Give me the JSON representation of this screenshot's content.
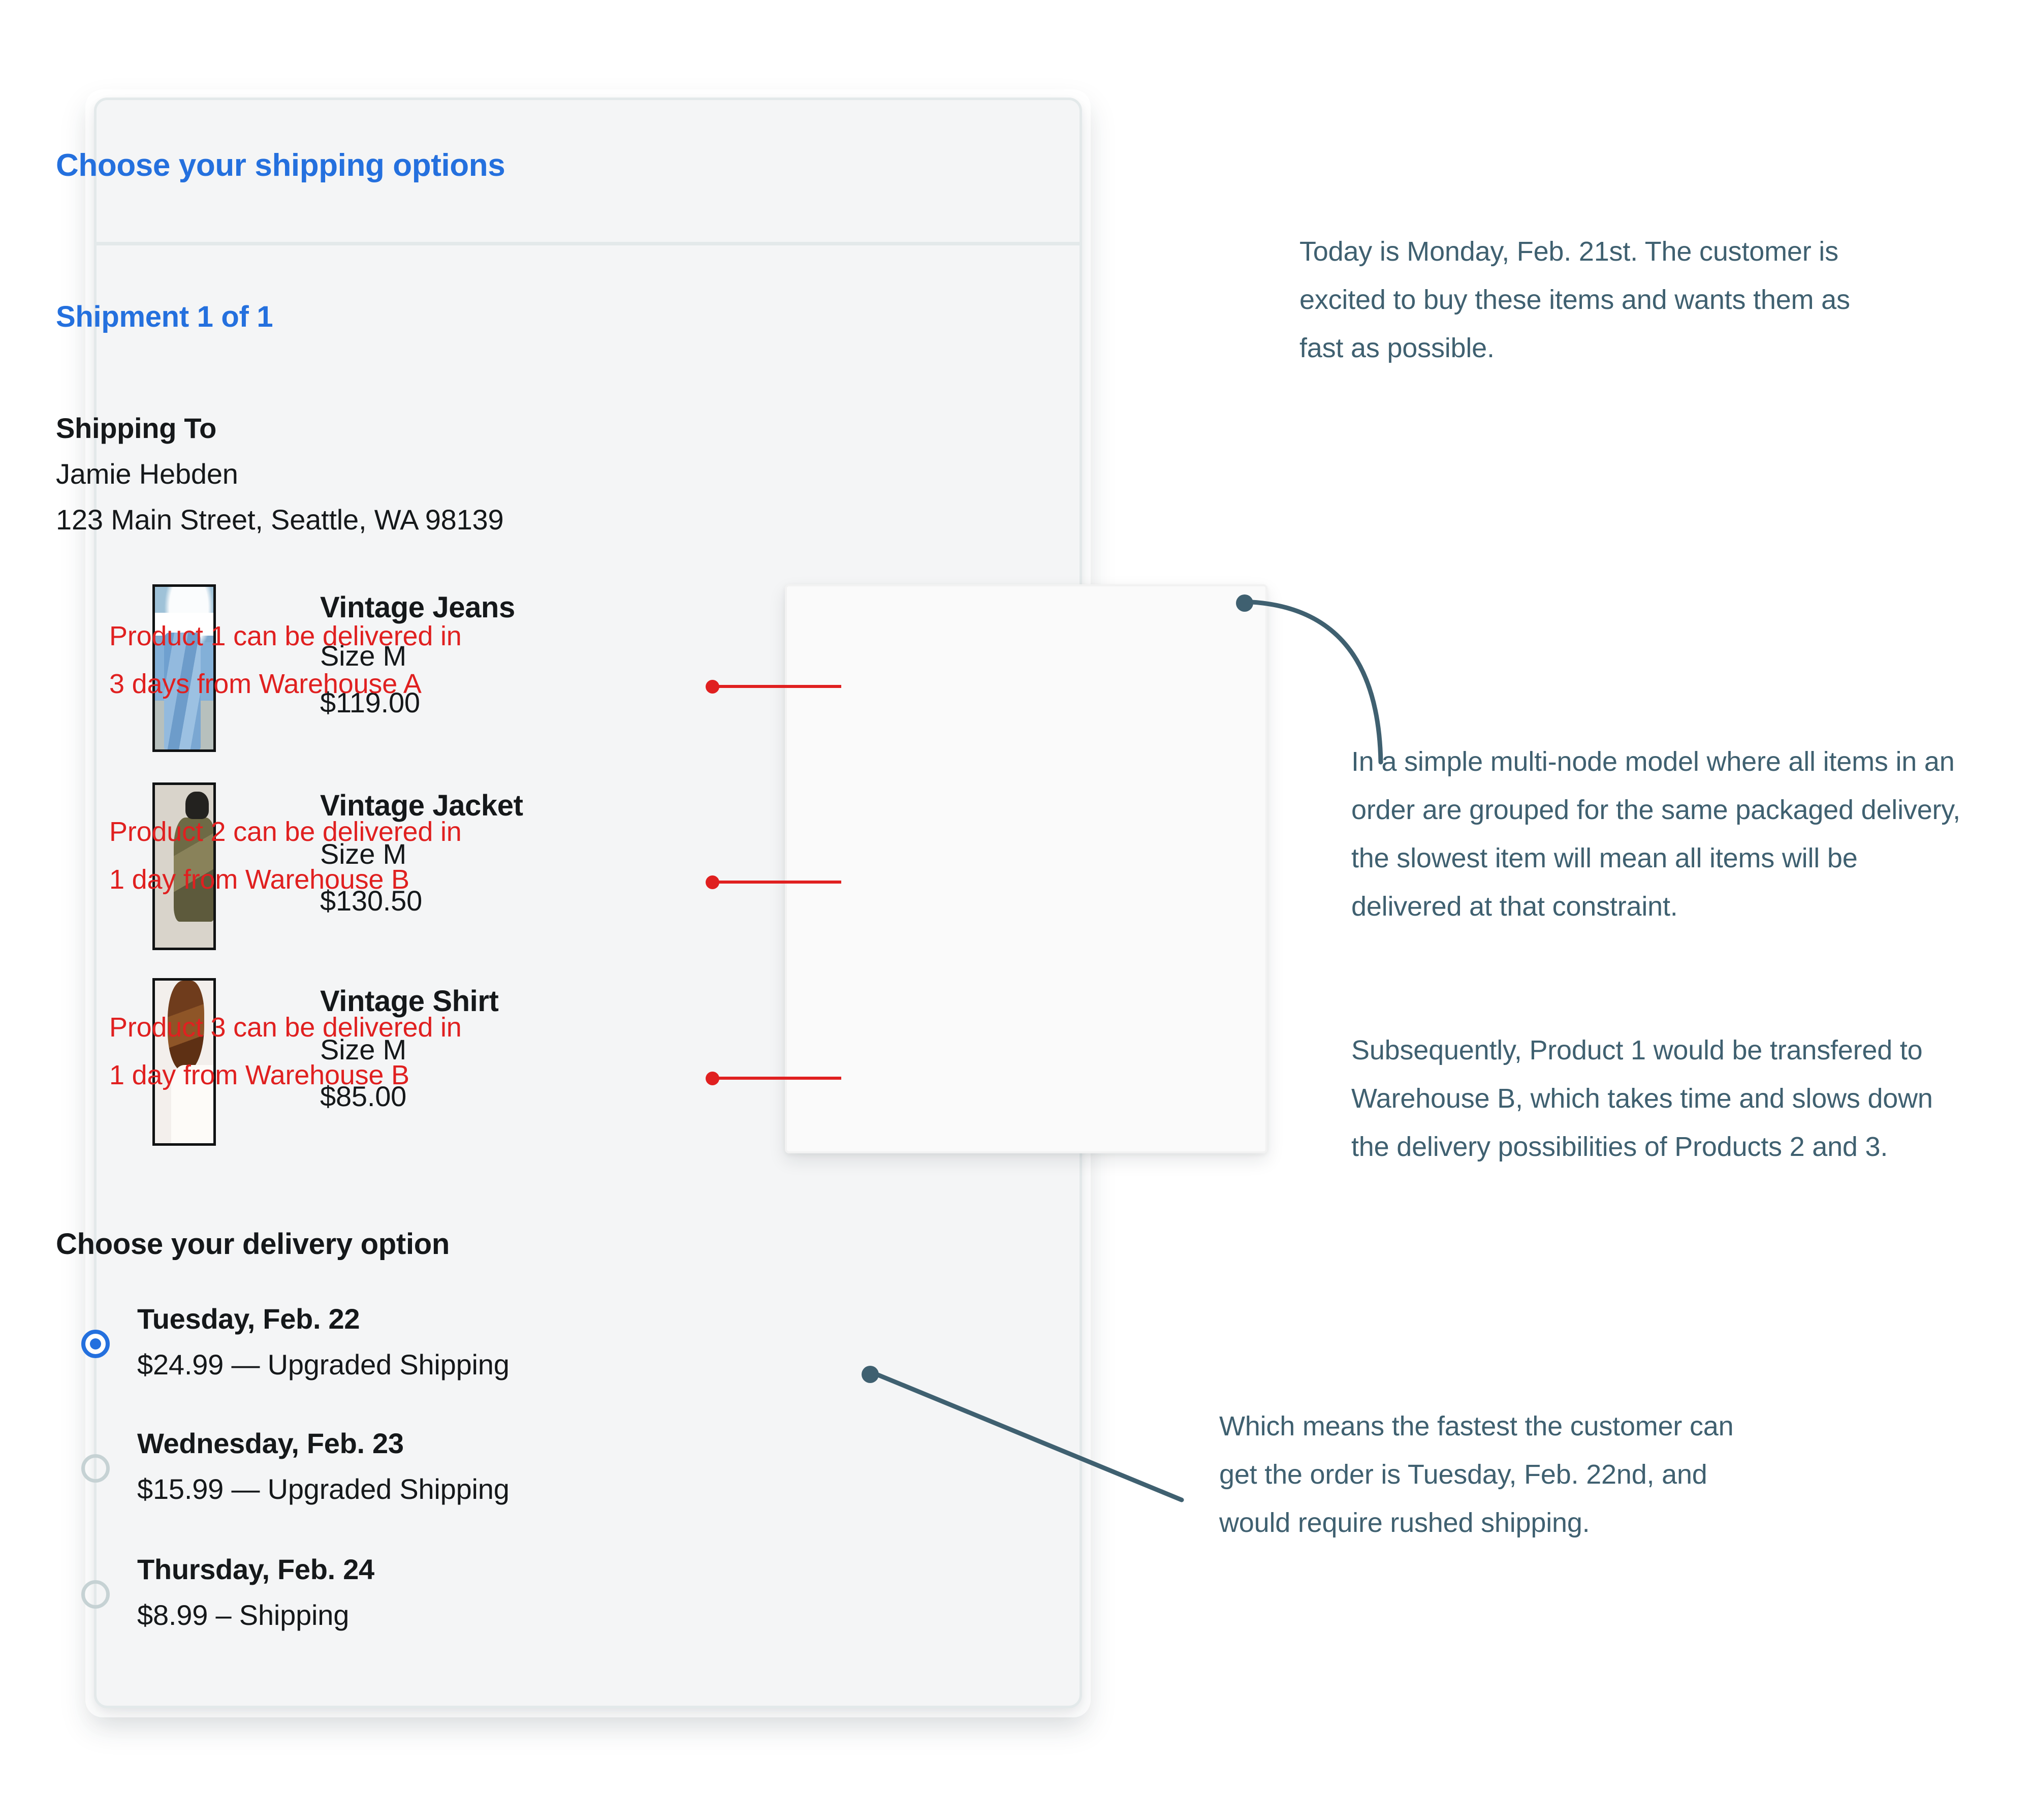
{
  "card": {
    "title": "Choose your shipping options",
    "shipment_label": "Shipment 1 of 1",
    "ship_to_label": "Shipping To",
    "ship_to_name": "Jamie Hebden",
    "ship_to_address": "123 Main Street, Seattle, WA 98139",
    "delivery_title": "Choose your delivery option"
  },
  "products": [
    {
      "name": "Vintage Jeans",
      "size": "Size M",
      "price": "$119.00",
      "thumb": "jeans-thumbnail"
    },
    {
      "name": "Vintage Jacket",
      "size": "Size M",
      "price": "$130.50",
      "thumb": "jacket-thumbnail"
    },
    {
      "name": "Vintage Shirt",
      "size": "Size M",
      "price": "$85.00",
      "thumb": "shirt-thumbnail"
    }
  ],
  "delivery_options": [
    {
      "day": "Tuesday, Feb. 22",
      "price": "$24.99 — Upgraded  Shipping",
      "selected": true
    },
    {
      "day": "Wednesday, Feb. 23",
      "price": "$15.99 — Upgraded Shipping",
      "selected": false
    },
    {
      "day": "Thursday, Feb. 24",
      "price": "$8.99 – Shipping",
      "selected": false
    }
  ],
  "red_annotations": [
    "Product 1 can be delivered in 3 days from Warehouse A",
    "Product 2 can be delivered in 1 day from Warehouse B",
    "Product 3 can be delivered in 1 day from Warehouse B"
  ],
  "notes": {
    "top": "Today is Monday, Feb. 21st. The customer is excited to buy these items and wants them as fast as possible.",
    "middle": "In a simple multi-node model where all items in an order are grouped for the same packaged delivery, the slowest item will mean all items will be delivered at that constraint.",
    "middle2": "Subsequently, Product 1 would be transfered to Warehouse B, which takes time and slows down the delivery possibilities of Products 2 and 3.",
    "bottom": "Which means the fastest the customer can get the order is Tuesday, Feb. 22nd, and would require rushed shipping."
  },
  "colors": {
    "accent_blue": "#2470DE",
    "annotation_red": "#E02020",
    "note_slate": "#3F6070",
    "card_fill": "#F4F5F6",
    "card_border": "#E3E9EA"
  }
}
